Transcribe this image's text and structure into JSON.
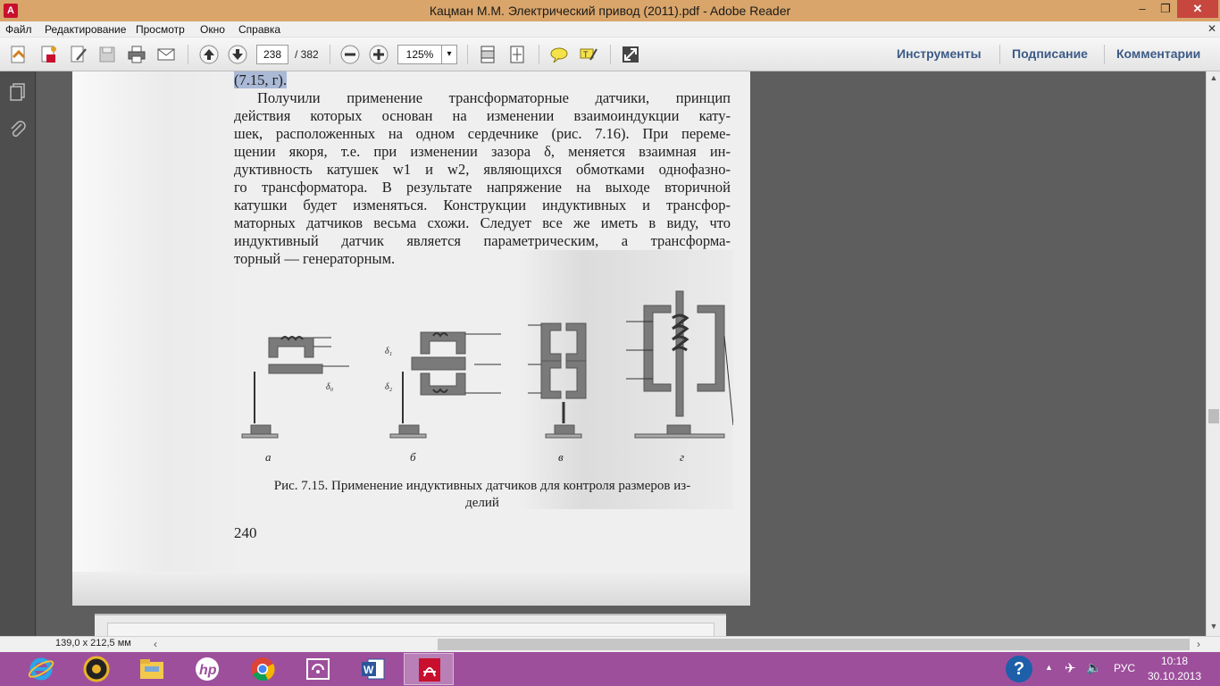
{
  "window": {
    "title": "Кацман М.М. Электрический привод (2011).pdf - Adobe Reader",
    "app_icon": "adobe-reader-icon",
    "minimize_glyph": "–",
    "maximize_glyph": "❐",
    "close_glyph": "✕"
  },
  "menu": {
    "items": [
      "Файл",
      "Редактирование",
      "Просмотр",
      "Окно",
      "Справка"
    ],
    "close_glyph": "✕"
  },
  "toolbar": {
    "current_page": "238",
    "total_pages": "/ 382",
    "zoom": "125%",
    "zoom_caret": "▾",
    "right_links": [
      "Инструменты",
      "Подписание",
      "Комментарии"
    ],
    "icons": [
      "create-pdf-icon",
      "convert-icon",
      "edit-icon",
      "save-icon",
      "print-icon",
      "email-icon",
      "prev-page-icon",
      "next-page-icon",
      "zoom-out-icon",
      "zoom-in-icon",
      "fit-width-icon",
      "fit-page-icon",
      "comment-icon",
      "highlight-icon",
      "fullscreen-icon"
    ]
  },
  "leftnav": {
    "icons": [
      "pages-icon",
      "attachments-icon"
    ]
  },
  "document": {
    "lines": [
      {
        "text": "(7.15, г).",
        "highlight": true
      },
      {
        "text": "Получили применение трансформаторные датчики, принцип",
        "indent": true
      },
      {
        "text": "действия которых основан на изменении взаимоиндукции кату-"
      },
      {
        "text": "шек, расположенных на одном сердечнике (рис. 7.16). При переме-"
      },
      {
        "text": "щении якоря, т.е. при изменении зазора δ, меняется взаимная ин-"
      },
      {
        "text": "дуктивность катушек w1 и w2, являющихся обмотками однофазно-"
      },
      {
        "text": "го трансформатора. В результате напряжение на выходе вторичной"
      },
      {
        "text": "катушки будет изменяться. Конструкции индуктивных и трансфор-"
      },
      {
        "text": "маторных датчиков весьма схожи. Следует все же иметь в виду, что"
      },
      {
        "text": "индуктивный датчик является параметрическим, а трансформа-"
      },
      {
        "text": "торный — генераторным.",
        "last": true
      }
    ],
    "figure_labels": [
      "а",
      "б",
      "в",
      "г"
    ],
    "gap_labels": [
      "δ₀",
      "δ₁",
      "δ₂"
    ],
    "caption_line1": "Рис. 7.15. Применение индуктивных датчиков для контроля размеров из-",
    "caption_line2": "делий",
    "page_number": "240"
  },
  "statusbar": {
    "page_size": "139,0 x 212,5 мм",
    "left_arrow": "‹",
    "right_arrow": "›"
  },
  "scrollbar": {
    "up": "▲",
    "down": "▼"
  },
  "taskbar": {
    "apps": [
      {
        "name": "internet-explorer",
        "active": false
      },
      {
        "name": "media-player",
        "active": false
      },
      {
        "name": "file-explorer",
        "active": false
      },
      {
        "name": "hp",
        "active": false
      },
      {
        "name": "chrome",
        "active": false
      },
      {
        "name": "remote-app",
        "active": false
      },
      {
        "name": "word",
        "active": false
      },
      {
        "name": "adobe-reader",
        "active": true
      }
    ],
    "tray": {
      "help": "?",
      "up_arrow": "▲",
      "airplane": "✈",
      "volume": "🔈",
      "language": "РУС",
      "time": "10:18",
      "date": "30.10.2013"
    }
  },
  "colors": {
    "titlebar": "#d9a56a",
    "taskbar": "#9d4f9c",
    "link": "#3c5a86",
    "highlight": "#aab9d6"
  }
}
